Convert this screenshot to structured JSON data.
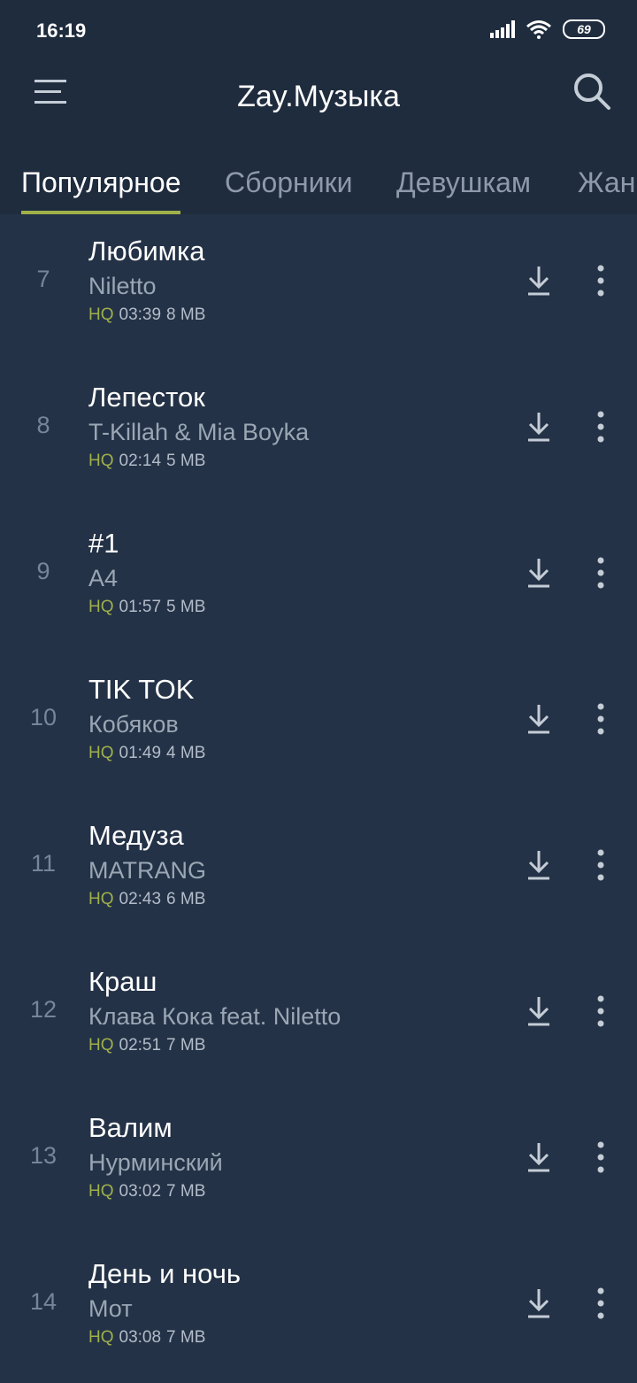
{
  "status": {
    "time": "16:19",
    "battery": "69"
  },
  "header": {
    "title": "Zay.Музыка"
  },
  "tabs": [
    {
      "label": "Популярное",
      "active": true
    },
    {
      "label": "Сборники",
      "active": false
    },
    {
      "label": "Девушкам",
      "active": false
    },
    {
      "label": "Жанры",
      "active": false
    }
  ],
  "colors": {
    "background": "#243247",
    "header": "#1f2c3e",
    "accent": "#a0b14a"
  },
  "tracks": [
    {
      "num": "7",
      "title": "Любимка",
      "artist": "Niletto",
      "quality": "HQ",
      "duration": "03:39",
      "size": "8 MB"
    },
    {
      "num": "8",
      "title": "Лепесток",
      "artist": "T-Killah & Mia Boyka",
      "quality": "HQ",
      "duration": "02:14",
      "size": "5 MB"
    },
    {
      "num": "9",
      "title": "#1",
      "artist": "A4",
      "quality": "HQ",
      "duration": "01:57",
      "size": "5 MB"
    },
    {
      "num": "10",
      "title": "TIK TOK",
      "artist": "Кобяков",
      "quality": "HQ",
      "duration": "01:49",
      "size": "4 MB"
    },
    {
      "num": "11",
      "title": "Медуза",
      "artist": "MATRANG",
      "quality": "HQ",
      "duration": "02:43",
      "size": "6 MB"
    },
    {
      "num": "12",
      "title": "Краш",
      "artist": "Клава Кока feat. Niletto",
      "quality": "HQ",
      "duration": "02:51",
      "size": "7 MB"
    },
    {
      "num": "13",
      "title": "Валим",
      "artist": "Нурминский",
      "quality": "HQ",
      "duration": "03:02",
      "size": "7 MB"
    },
    {
      "num": "14",
      "title": "День и ночь",
      "artist": "Мот",
      "quality": "HQ",
      "duration": "03:08",
      "size": "7 MB"
    }
  ]
}
